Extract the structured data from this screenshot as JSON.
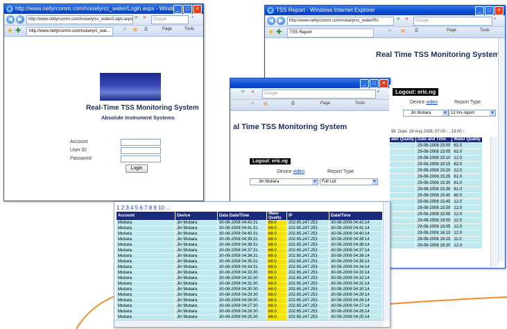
{
  "login_window": {
    "title": "http://www.netlyrcomm.com/noiselyrcc_water/Login.aspx - Windows Internet Explorer",
    "address": "http://www.netlyrcomm.com/noiselyrcc_water/Login.aspx",
    "search_placeholder": "Google",
    "tab_label": "http://www.netlyrcomm.com/noiselyrc_wat...",
    "toolbar": {
      "page": "Page",
      "tools": "Tools"
    },
    "heading": "Real-Time TSS Monitoring System",
    "subheading": "Absolute Instrument Systems",
    "account_label": "Account",
    "userid_label": "User ID",
    "password_label": "Password",
    "login_button": "Login"
  },
  "report_window": {
    "title": "TSS Report - Windows Internet Explorer",
    "address": "http://www.netlyrcomm.com/noiselyrcc_water/Rc",
    "search_placeholder": "Google",
    "tab_label": "TSS Report",
    "toolbar": {
      "page": "Page",
      "tools": "Tools"
    },
    "heading": "Real Time TSS Monitoring System",
    "logout": "Logout: eric.ng",
    "device_label": "Device",
    "device_link": "video",
    "report_type_label": "Report Type",
    "device_value": "Jin Mutiara",
    "report_value": "12 hrs report",
    "date_range": "Date: 29 Aug 2008, 07:00 - , 19:00 -",
    "row_prefix": "98",
    "headers": [
      "ater Quality",
      "Date and Time",
      "Water Quality"
    ],
    "rows": [
      [
        "",
        "29-08-2008 15:00",
        "62.0"
      ],
      [
        "",
        "29-08-2008 15:05",
        "62.0"
      ],
      [
        "",
        "29-08-2008 15:10",
        "12.0"
      ],
      [
        "",
        "29-08-2008 15:15",
        "62.0"
      ],
      [
        "",
        "29-08-2008 15:20",
        "12.0"
      ],
      [
        "",
        "29-08-2008 15:25",
        "61.0"
      ],
      [
        "",
        "29-08-2008 15:30",
        "61.0"
      ],
      [
        "",
        "29-08-2008 15:35",
        "61.0"
      ],
      [
        "",
        "29-08-2008 15:40",
        "80.0"
      ],
      [
        "",
        "29-08-2008 15:45",
        "12.0"
      ],
      [
        "",
        "29-08-2008 15:50",
        "12.0"
      ],
      [
        "",
        "29-08-2008 15:55",
        "12.0"
      ],
      [
        "",
        "29-08-2008 16:00",
        "12.0"
      ],
      [
        "",
        "29-08-2008 16:05",
        "12.0"
      ],
      [
        "",
        "29-08-2008 16:10",
        "12.0"
      ],
      [
        "",
        "29-08-2008 16:15",
        "11.0"
      ],
      [
        "",
        "29-08-2008 16:20",
        "12.0"
      ]
    ]
  },
  "middle_window": {
    "search_placeholder": "Google",
    "toolbar": {
      "page": "Page",
      "tools": "Tools"
    },
    "heading": "al Time TSS Monitoring System",
    "logout": "Logout: eric.ng",
    "device_label": "Device",
    "device_link": "video",
    "report_type_label": "Report Type",
    "device_value": "Jin Mutiara",
    "report_value": "Full List",
    "pager": "1 2 3 4 5 6 7 8 9 10 ...",
    "headers": [
      "Account",
      "Device",
      "Data Date/Time",
      "Water Quality",
      "IP",
      "Date/Time"
    ],
    "rows": [
      [
        "Mutiara",
        "Jin Mutiara",
        "30-08-2008 04:42:31",
        "68.0",
        "202.65.247.253",
        "30-08-2008 04:42:14"
      ],
      [
        "Mutiara",
        "Jin Mutiara",
        "30-08-2008 04:41:31",
        "68.0",
        "202.65.247.253",
        "30-08-2008 04:41:14"
      ],
      [
        "Mutiara",
        "Jin Mutiara",
        "30-08-2008 04:40:31",
        "68.0",
        "202.65.247.253",
        "30-08-2008 04:40:14"
      ],
      [
        "Mutiara",
        "Jin Mutiara",
        "30-08-2008 04:39:31",
        "68.0",
        "202.65.247.253",
        "30-08-2008 04:39:14"
      ],
      [
        "Mutiara",
        "Jin Mutiara",
        "30-08-2008 04:38:31",
        "68.0",
        "202.65.247.253",
        "30-08-2008 04:38:14"
      ],
      [
        "Mutiara",
        "Jin Mutiara",
        "30-08-2008 04:37:31",
        "68.0",
        "202.65.247.253",
        "30-08-2008 04:37:14"
      ],
      [
        "Mutiara",
        "Jin Mutiara",
        "30-08-2008 04:36:31",
        "68.0",
        "202.65.247.253",
        "30-08-2008 04:36:14"
      ],
      [
        "Mutiara",
        "Jin Mutiara",
        "30-08-2008 04:35:31",
        "68.0",
        "202.65.247.253",
        "30-08-2008 04:35:14"
      ],
      [
        "Mutiara",
        "Jin Mutiara",
        "30-08-2008 04:34:31",
        "68.0",
        "202.65.247.253",
        "30-08-2008 04:34:14"
      ],
      [
        "Mutiara",
        "Jin Mutiara",
        "30-08-2008 04:33:30",
        "68.0",
        "202.65.247.253",
        "30-08-2008 04:33:14"
      ],
      [
        "Mutiara",
        "Jin Mutiara",
        "30-08-2008 04:32:30",
        "68.0",
        "202.65.247.253",
        "30-08-2008 04:32:14"
      ],
      [
        "Mutiara",
        "Jin Mutiara",
        "30-08-2008 04:31:30",
        "68.0",
        "202.65.247.253",
        "30-08-2008 04:31:14"
      ],
      [
        "Mutiara",
        "Jin Mutiara",
        "30-08-2008 04:30:30",
        "68.0",
        "202.65.247.253",
        "30-08-2008 04:30:14"
      ],
      [
        "Mutiara",
        "Jin Mutiara",
        "30-08-2008 04:29:30",
        "68.0",
        "202.65.247.253",
        "30-08-2008 04:29:14"
      ],
      [
        "Mutiara",
        "Jin Mutiara",
        "30-08-2008 04:28:30",
        "68.0",
        "202.65.247.253",
        "30-08-2008 04:28:14"
      ],
      [
        "Mutiara",
        "Jin Mutiara",
        "30-08-2008 04:27:30",
        "68.0",
        "202.65.247.253",
        "30-08-2008 04:27:14"
      ],
      [
        "Mutiara",
        "Jin Mutiara",
        "30-08-2008 04:26:30",
        "68.0",
        "202.65.247.253",
        "30-08-2008 04:26:14"
      ],
      [
        "Mutiara",
        "Jin Mutiara",
        "30-08-2008 04:25:30",
        "68.0",
        "202.65.247.253",
        "30-08-2008 04:25:14"
      ]
    ]
  },
  "colors": {
    "titlebar": "#0a4bd1",
    "header_navy": "#1a2a7a",
    "row_teal": "#bfe9ef",
    "quality_yellow": "#f2e20f",
    "accent_orange": "#f08a24"
  }
}
